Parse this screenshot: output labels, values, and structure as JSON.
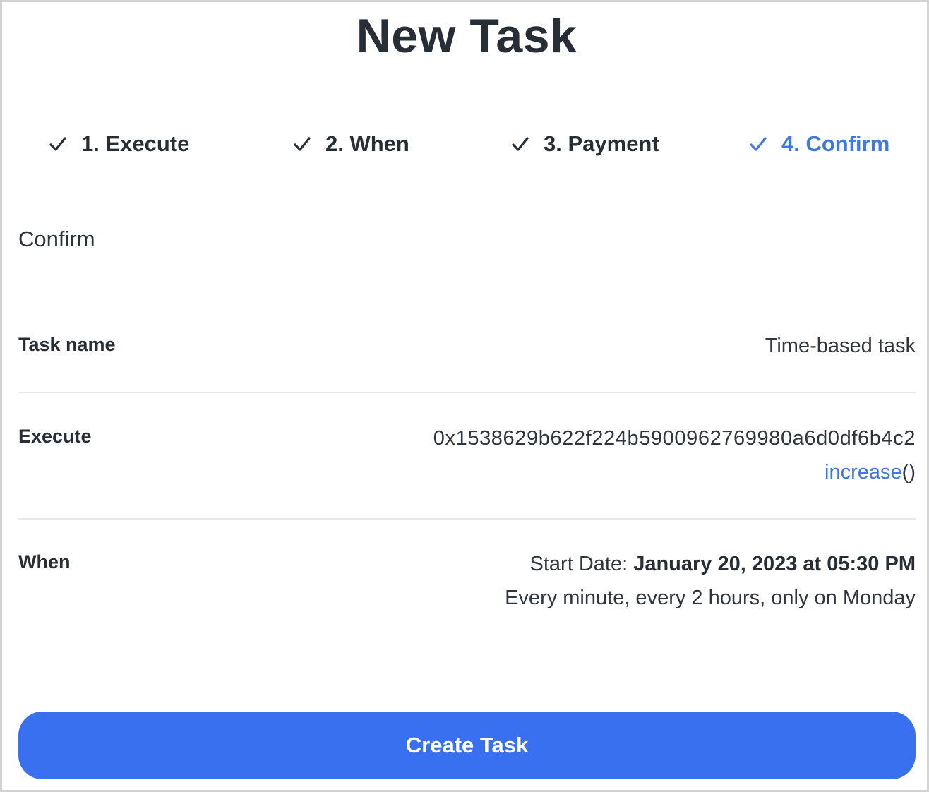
{
  "title": "New Task",
  "steps": [
    {
      "label": "1. Execute",
      "icon": "check-icon",
      "active": false
    },
    {
      "label": "2. When",
      "icon": "check-icon",
      "active": false
    },
    {
      "label": "3. Payment",
      "icon": "check-icon",
      "active": false
    },
    {
      "label": "4. Confirm",
      "icon": "check-icon",
      "active": true
    }
  ],
  "section_heading": "Confirm",
  "details": {
    "task_name": {
      "label": "Task name",
      "value": "Time-based task"
    },
    "execute": {
      "label": "Execute",
      "address": "0x1538629b622f224b5900962769980a6d0df6b4c2",
      "function_name": "increase",
      "function_parens": "()"
    },
    "when": {
      "label": "When",
      "start_prefix": "Start Date: ",
      "start_date": "January 20, 2023 at 05:30 PM",
      "schedule": "Every minute, every 2 hours, only on Monday"
    }
  },
  "create_button_label": "Create Task",
  "colors": {
    "accent": "#3870f0",
    "active_step": "#3d78e6",
    "text": "#272e36",
    "divider": "#e6e8eb"
  }
}
